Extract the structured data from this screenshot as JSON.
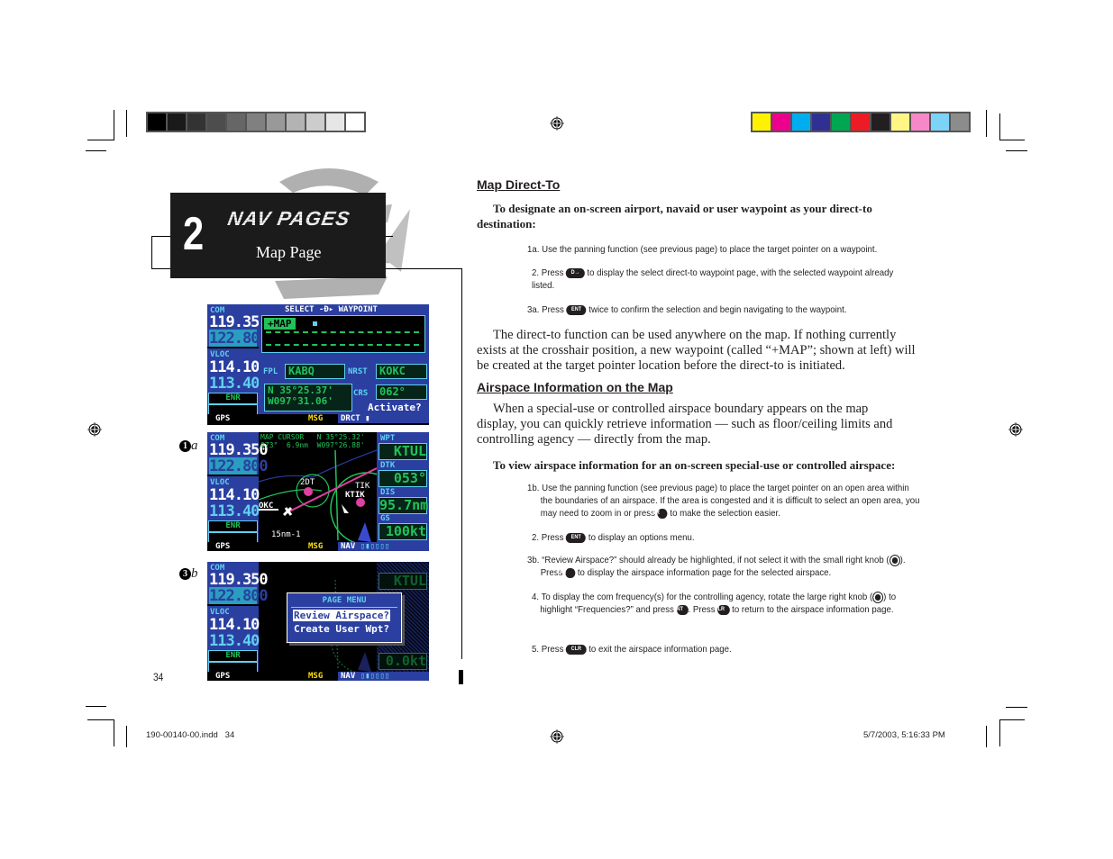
{
  "print_marks": {
    "gray_swatches": [
      "#000000",
      "#1a1a1a",
      "#333333",
      "#4d4d4d",
      "#666666",
      "#808080",
      "#999999",
      "#b3b3b3",
      "#cccccc",
      "#e6e6e6",
      "#ffffff"
    ],
    "color_swatches": [
      "#fff200",
      "#ec008c",
      "#00aeef",
      "#2e3192",
      "#00a651",
      "#ed1c24",
      "#231f20",
      "#fff685",
      "#f688c8",
      "#7dd3f7",
      "#8c8c8c"
    ]
  },
  "chapter": {
    "number": "2",
    "title": "NAV PAGES",
    "subtitle": "Map Page"
  },
  "screens": {
    "common": {
      "com_label": "COM",
      "com_active": "119.350",
      "com_standby": "122.800",
      "vloc_label": "VLOC",
      "vloc_active": "114.10",
      "vloc_standby": "113.40",
      "mode": "ENR",
      "gps": "GPS",
      "msg": "MSG"
    },
    "screen1": {
      "header": "SELECT",
      "header_right": "WAYPOINT",
      "waypoint": "+MAP",
      "fpl_label": "FPL",
      "fpl_value": "KABQ",
      "nrst_label": "NRST",
      "nrst_value": "KOKC",
      "lat": "N  35°25.37'",
      "lon": "W097°31.06'",
      "crs_label": "CRS",
      "crs_value": "062°",
      "activate": "Activate?",
      "status": "DRCT"
    },
    "screen2": {
      "cursor_label": "MAP CURSOR",
      "cursor_lat": "N  35°25.32'",
      "cursor_brg": "073°",
      "cursor_dist": "6.9nm",
      "cursor_lon": "W097°26.88'",
      "wpt_label": "WPT",
      "wpt_value": "KTUL",
      "dtk_label": "DTK",
      "dtk_value": "053°",
      "dis_label": "DIS",
      "dis_value": "95.7nm",
      "gs_label": "GS",
      "gs_value": "100kt",
      "map_labels": [
        "2DT",
        "TIK",
        "KTIK",
        "OKC",
        "15nm-1"
      ],
      "status": "NAV"
    },
    "screen3": {
      "menu_title": "PAGE MENU",
      "menu_items": [
        "Review Airspace?",
        "Create User Wpt?"
      ],
      "selected_item": "Review Airspace?",
      "wpt_value": "KTUL",
      "gs_value": "0.0kt",
      "status": "NAV"
    },
    "bullets": [
      {
        "num": "1",
        "letter": "a"
      },
      {
        "num": "3",
        "letter": "b"
      }
    ]
  },
  "content": {
    "section1_title": "Map Direct-To",
    "section1_intro": "To designate an on-screen airport, navaid or user waypoint as your direct-to destination:",
    "steps1": [
      {
        "num": "1a.",
        "text": "Use the panning function (see previous page) to place the target pointer on a waypoint."
      },
      {
        "num": "2.",
        "pre": "Press",
        "key": "D→",
        "text": "to display the select direct-to waypoint page, with the selected waypoint already listed."
      },
      {
        "num": "3a.",
        "pre": "Press",
        "key": "ENT",
        "text": "twice to confirm the selection and begin navigating to the waypoint."
      }
    ],
    "para1": "The direct-to function can be used anywhere on the map. If nothing currently exists at the crosshair position, a new waypoint (called “+MAP”; shown at left) will be created at the target pointer location before the direct-to is initiated.",
    "section2_title": "Airspace Information on the Map",
    "para2": "When a special-use or controlled airspace boundary appears on the map display, you can quickly retrieve information — such as floor/ceiling limits and controlling agency — directly from the map.",
    "section2_intro": "To view airspace information for an on-screen special-use or controlled airspace:",
    "steps2": [
      {
        "num": "1b.",
        "text_a": "Use the panning function (see previous page) to place the target pointer on an open area within the boundaries of an airspace.  If the area is congested and it is difficult to select an open area, you may need to zoom in or press",
        "key": "CLR",
        "text_b": "to make the selection easier."
      },
      {
        "num": "2.",
        "pre": "Press",
        "key": "ENT",
        "text": "to display an options menu."
      },
      {
        "num": "3b.",
        "text_a": "“Review Airspace?” should already be highlighted, if not select it with the small right knob (",
        "text_b": ").",
        "line2_pre": "Press",
        "key": "ENT",
        "line2": "to display the airspace information page for the selected airspace."
      },
      {
        "num": "4.",
        "text_a": "To display the com frequency(s) for the controlling agency, rotate the large right knob (",
        "text_b": ") to highlight “Frequencies?” and press",
        "key1": "ENT",
        "text_c": ".  Press",
        "key2": "CLR",
        "text_d": "to return to the airspace information page."
      },
      {
        "num": "5.",
        "pre": "Press",
        "key": "CLR",
        "text": "to exit the airspace information page."
      }
    ]
  },
  "footer": {
    "page_number": "34",
    "file": "190-00140-00.indd   34",
    "timestamp": "5/7/2003, 5:16:33 PM"
  }
}
